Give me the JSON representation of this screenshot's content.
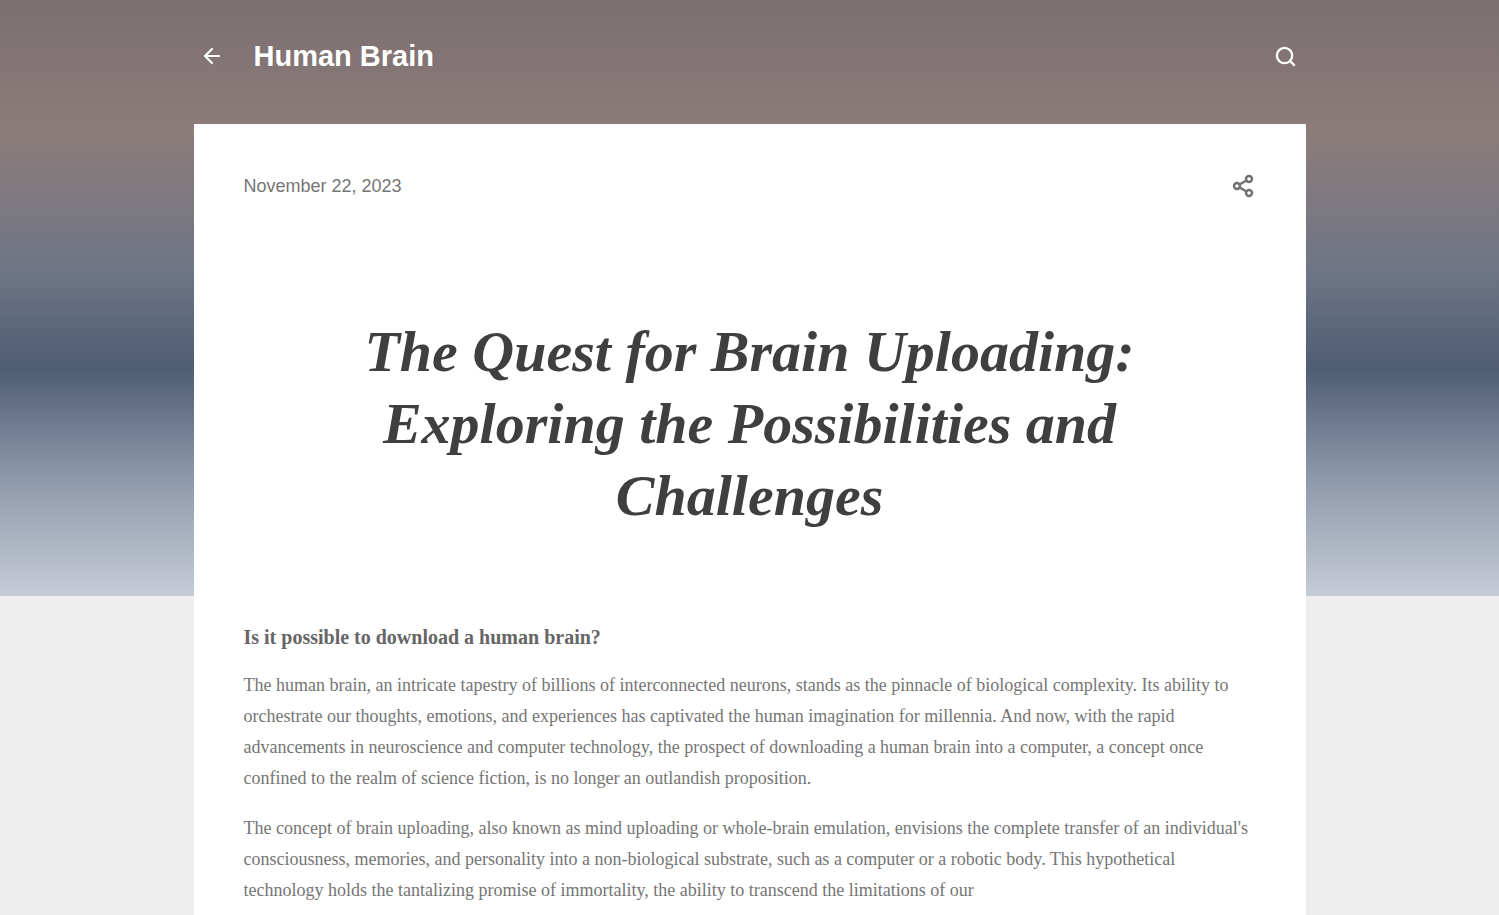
{
  "blog": {
    "title": "Human Brain"
  },
  "post": {
    "date": "November 22, 2023",
    "title": "The Quest for Brain Uploading: Exploring the Possibilities and Challenges",
    "heading": "Is it possible to download a human brain?",
    "paragraphs": [
      "The human brain, an intricate tapestry of billions of interconnected neurons, stands as the pinnacle of biological complexity. Its ability to orchestrate our thoughts, emotions, and experiences has captivated the human imagination for millennia. And now, with the rapid advancements in neuroscience and computer technology, the prospect of downloading a human brain into a computer, a concept once confined to the realm of science fiction, is no longer an outlandish proposition.",
      "The concept of brain uploading, also known as mind uploading or whole-brain emulation, envisions the complete transfer of an individual's consciousness, memories, and personality into a non-biological substrate, such as a computer or a robotic body. This hypothetical technology holds the tantalizing promise of immortality, the ability to transcend the limitations of our"
    ]
  }
}
